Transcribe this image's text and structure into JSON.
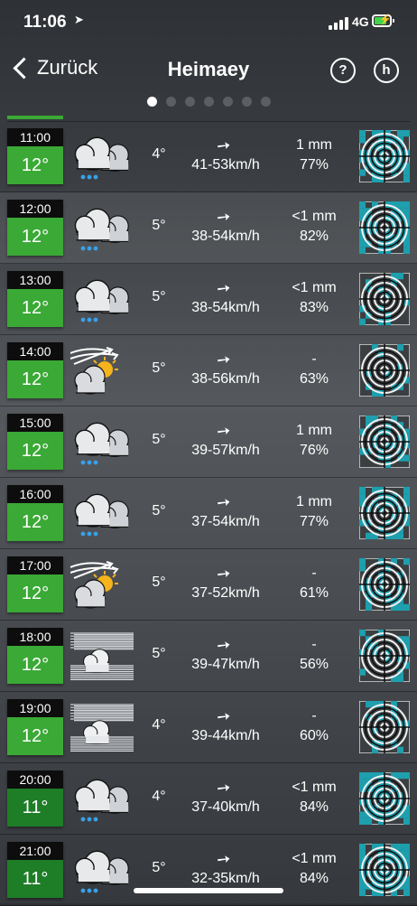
{
  "status": {
    "time": "11:06",
    "network": "4G"
  },
  "nav": {
    "back_label": "Zurück",
    "title": "Heimaey",
    "help_label": "?",
    "h_label": "h"
  },
  "pagination": {
    "count": 7,
    "active_index": 0
  },
  "forecast": [
    {
      "hour": "11:00",
      "badge": "12°",
      "icon": "cloud-snow-icon",
      "temp": "4°",
      "wind": "41-53km/h",
      "precip": "1 mm",
      "humidity": "77%",
      "radar_level": 0.7
    },
    {
      "hour": "12:00",
      "badge": "12°",
      "icon": "cloud-snow-icon",
      "temp": "5°",
      "wind": "38-54km/h",
      "precip": "<1 mm",
      "humidity": "82%",
      "radar_level": 0.6
    },
    {
      "hour": "13:00",
      "badge": "12°",
      "icon": "cloud-snow-icon",
      "temp": "5°",
      "wind": "38-54km/h",
      "precip": "<1 mm",
      "humidity": "83%",
      "radar_level": 0.3
    },
    {
      "hour": "14:00",
      "badge": "12°",
      "icon": "wind-sun-cloud-icon",
      "temp": "5°",
      "wind": "38-56km/h",
      "precip": "-",
      "humidity": "63%",
      "radar_level": 0.1
    },
    {
      "hour": "15:00",
      "badge": "12°",
      "icon": "cloud-snow-icon",
      "temp": "5°",
      "wind": "39-57km/h",
      "precip": "1 mm",
      "humidity": "76%",
      "radar_level": 0.4
    },
    {
      "hour": "16:00",
      "badge": "12°",
      "icon": "cloud-snow-icon",
      "temp": "5°",
      "wind": "37-54km/h",
      "precip": "1 mm",
      "humidity": "77%",
      "radar_level": 0.5
    },
    {
      "hour": "17:00",
      "badge": "12°",
      "icon": "wind-sun-cloud-icon",
      "temp": "5°",
      "wind": "37-52km/h",
      "precip": "-",
      "humidity": "61%",
      "radar_level": 0.4
    },
    {
      "hour": "18:00",
      "badge": "12°",
      "icon": "fog-cloud-icon",
      "temp": "5°",
      "wind": "39-47km/h",
      "precip": "-",
      "humidity": "56%",
      "radar_level": 0.35
    },
    {
      "hour": "19:00",
      "badge": "12°",
      "icon": "fog-cloud-icon",
      "temp": "4°",
      "wind": "39-44km/h",
      "precip": "-",
      "humidity": "60%",
      "radar_level": 0.3
    },
    {
      "hour": "20:00",
      "badge": "11°",
      "icon": "cloud-snow-icon",
      "temp": "4°",
      "wind": "37-40km/h",
      "precip": "<1 mm",
      "humidity": "84%",
      "radar_level": 0.75
    },
    {
      "hour": "21:00",
      "badge": "11°",
      "icon": "cloud-snow-icon",
      "temp": "5°",
      "wind": "32-35km/h",
      "precip": "<1 mm",
      "humidity": "84%",
      "radar_level": 0.75
    }
  ],
  "colors": {
    "badge_green": "#3aa935",
    "badge_dark_green": "#1e7d27",
    "radar_teal": "#1e9fae"
  }
}
